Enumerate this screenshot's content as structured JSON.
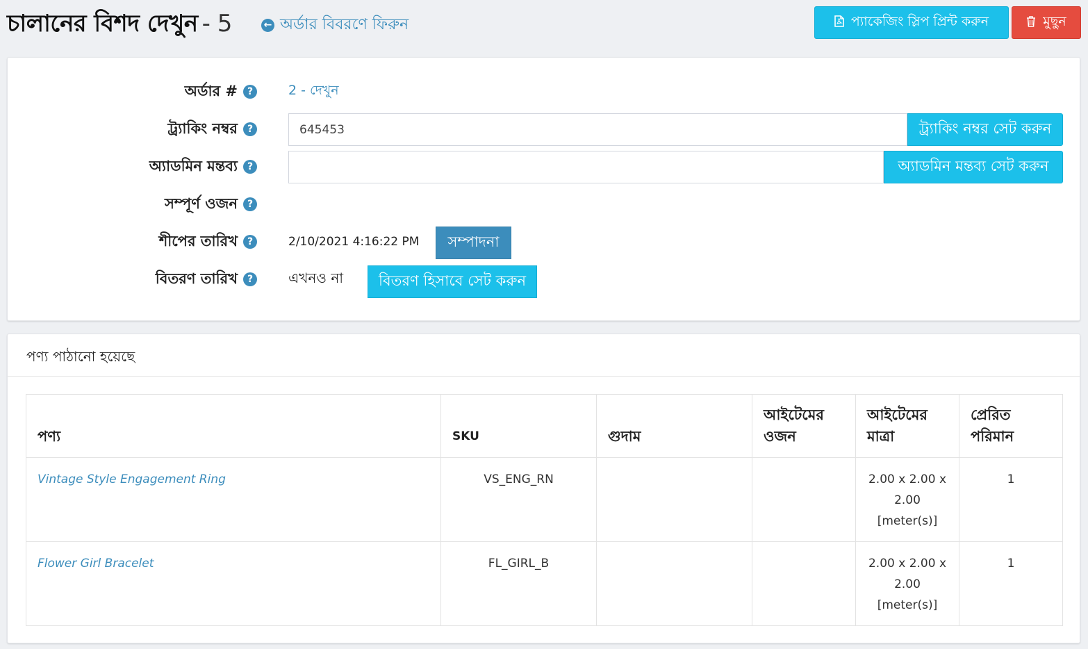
{
  "header": {
    "title": "চালানের বিশদ দেখুন",
    "title_suffix": "- 5",
    "back_link": "অর্ডার বিবরণে ফিরুন",
    "print_button": "প্যাকেজিং স্লিপ প্রিন্ট করুন",
    "delete_button": "মুছুন"
  },
  "info": {
    "order_label": "অর্ডার #",
    "order_value": "2 - দেখুন",
    "tracking_label": "ট্র্যাকিং নম্বর",
    "tracking_value": "645453",
    "tracking_button": "ট্র্যাকিং নম্বর সেট করুন",
    "admin_comment_label": "অ্যাডমিন মন্তব্য",
    "admin_comment_value": "",
    "admin_comment_button": "অ্যাডমিন মন্তব্য সেট করুন",
    "total_weight_label": "সম্পূর্ণ ওজন",
    "ship_date_label": "শীপের তারিখ",
    "ship_date_value": "2/10/2021 4:16:22 PM",
    "edit_button": "সম্পাদনা",
    "delivery_date_label": "বিতরণ তারিখ",
    "delivery_date_value": "এখনও না",
    "set_delivered_button": "বিতরণ হিসাবে সেট করুন",
    "help_glyph": "?"
  },
  "products": {
    "card_title": "পণ্য পাঠানো হয়েছে",
    "columns": [
      "পণ্য",
      "SKU",
      "গুদাম",
      "আইটেমের ওজন",
      "আইটেমের মাত্রা",
      "প্রেরিত পরিমান"
    ],
    "rows": [
      {
        "name": "Vintage Style Engagement Ring",
        "sku": "VS_ENG_RN",
        "warehouse": "",
        "weight": "",
        "dimensions": "2.00 x 2.00 x 2.00 [meter(s)]",
        "quantity": "1"
      },
      {
        "name": "Flower Girl Bracelet",
        "sku": "FL_GIRL_B",
        "warehouse": "",
        "weight": "",
        "dimensions": "2.00 x 2.00 x 2.00 [meter(s)]",
        "quantity": "1"
      }
    ]
  },
  "icons": {
    "back": "arrow-left-circle-icon",
    "print": "pdf-file-icon",
    "delete": "trash-icon",
    "help": "question-circle-icon"
  },
  "colors": {
    "info": "#1cc0ea",
    "primary": "#3c8dbc",
    "danger": "#e54c3f"
  }
}
